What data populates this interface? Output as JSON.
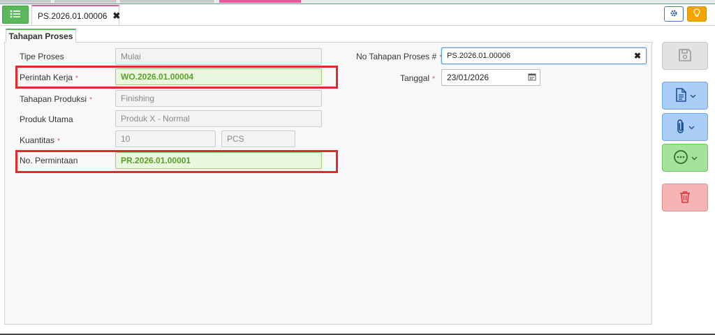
{
  "accent_color": "#e8579a",
  "header": {
    "menu_icon": "list-icon",
    "document_tab": {
      "title": "PS.2026.01.00006",
      "close_icon": "close-icon"
    },
    "settings_icon": "gear-icon",
    "tips_icon": "lightbulb-icon"
  },
  "panel": {
    "tab_label": "Tahapan Proses"
  },
  "form": {
    "tipe_proses": {
      "label": "Tipe Proses",
      "value": "Mulai"
    },
    "perintah_kerja": {
      "label": "Perintah Kerja",
      "required": "*",
      "value": "WO.2026.01.00004"
    },
    "tahapan_produksi": {
      "label": "Tahapan Produksi",
      "required": "*",
      "value": "Finishing"
    },
    "produk_utama": {
      "label": "Produk Utama",
      "value": "Produk X - Normal"
    },
    "kuantitas": {
      "label": "Kuantitas",
      "required": "*",
      "value": "10",
      "unit": "PCS"
    },
    "no_permintaan": {
      "label": "No. Permintaan",
      "value": "PR.2026.01.00001"
    },
    "no_tahapan_proses": {
      "label": "No Tahapan Proses #",
      "required": "*",
      "value": "PS.2026.01.00006"
    },
    "tanggal": {
      "label": "Tanggal",
      "required": "*",
      "value": "23/01/2026"
    }
  },
  "actions": {
    "save_icon": "save-icon",
    "document_icon": "document-icon",
    "attachment_icon": "paperclip-icon",
    "more_icon": "more-icon",
    "delete_icon": "trash-icon",
    "colors": {
      "save": "#e2e2e2",
      "document": "#a9cdf5",
      "more": "#a6e39a",
      "delete": "#f7b4b4"
    }
  }
}
